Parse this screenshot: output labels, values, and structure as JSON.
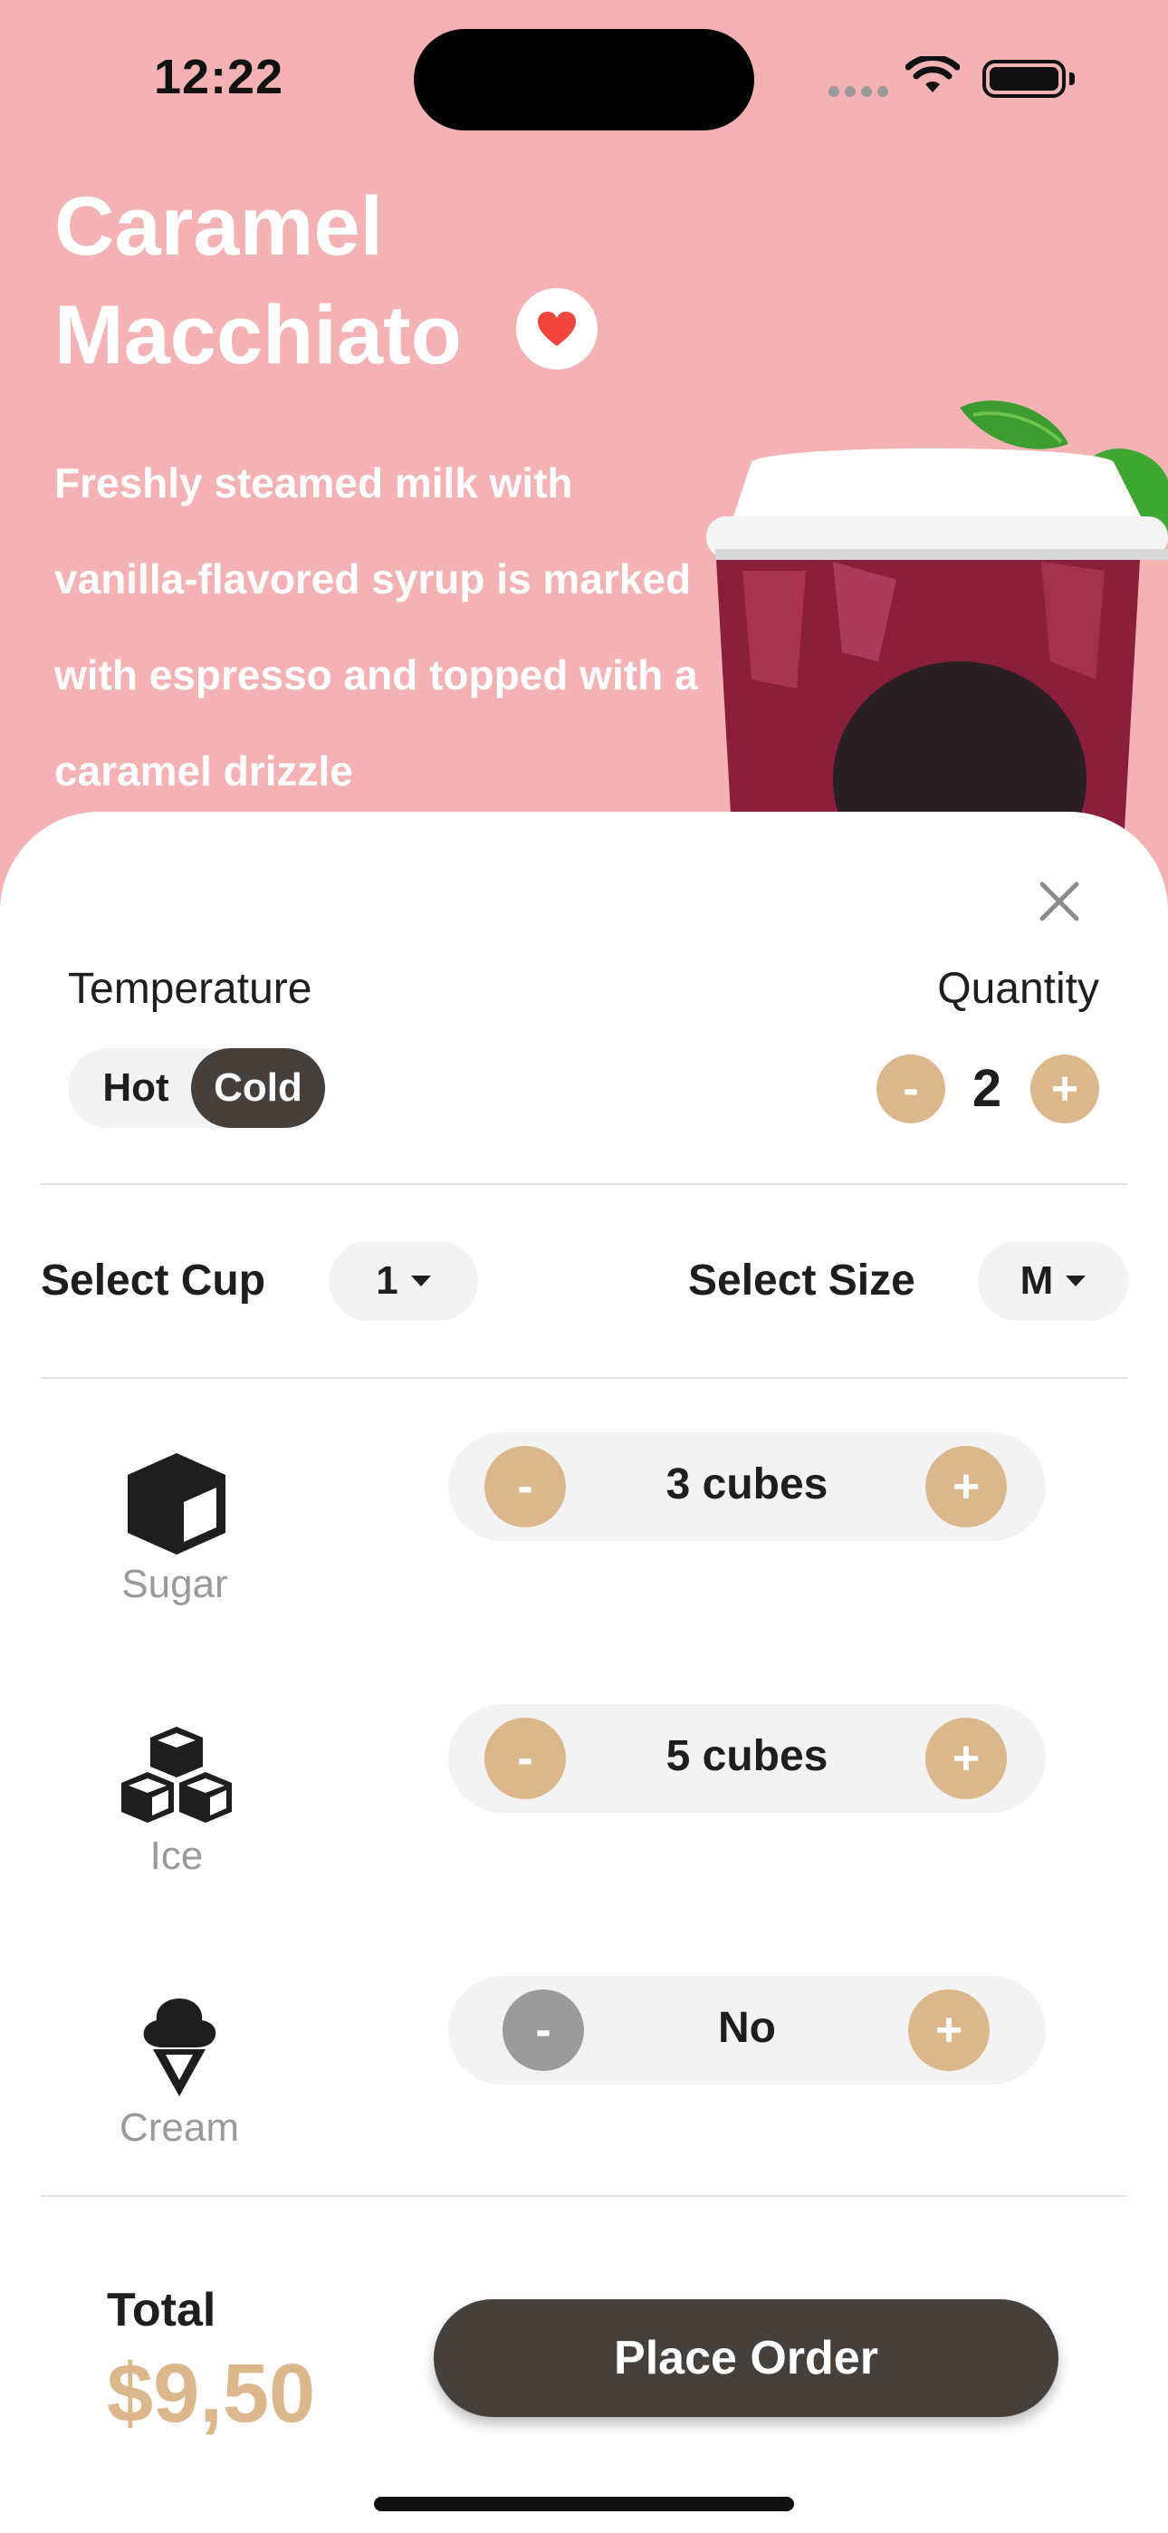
{
  "status_bar": {
    "time": "12:22"
  },
  "product": {
    "title": "Caramel Macchiato",
    "description": "Freshly steamed milk with vanilla-flavored syrup is marked with espresso and topped with a caramel drizzle",
    "favorite": true
  },
  "options": {
    "temperature_label": "Temperature",
    "temperature_options": [
      "Hot",
      "Cold"
    ],
    "temperature_selected": "Cold",
    "quantity_label": "Quantity",
    "quantity": "2",
    "minus_symbol": "-",
    "plus_symbol": "+",
    "select_cup_label": "Select Cup",
    "select_cup_value": "1",
    "select_size_label": "Select Size",
    "select_size_value": "M"
  },
  "addons": {
    "sugar": {
      "name": "Sugar",
      "value": "3 cubes"
    },
    "ice": {
      "name": "Ice",
      "value": "5 cubes"
    },
    "cream": {
      "name": "Cream",
      "value": "No"
    }
  },
  "footer": {
    "total_label": "Total",
    "total_value": "$9,50",
    "order_button": "Place Order"
  },
  "colors": {
    "hero_background": "#f4b2b5",
    "accent": "#dcb78c",
    "dark": "#46403d",
    "heart": "#f0443c"
  },
  "icons": [
    "wifi-icon",
    "battery-icon",
    "heart-icon",
    "close-icon",
    "sugar-cube-icon",
    "ice-cubes-icon",
    "ice-cream-icon",
    "chevron-down-icon"
  ]
}
